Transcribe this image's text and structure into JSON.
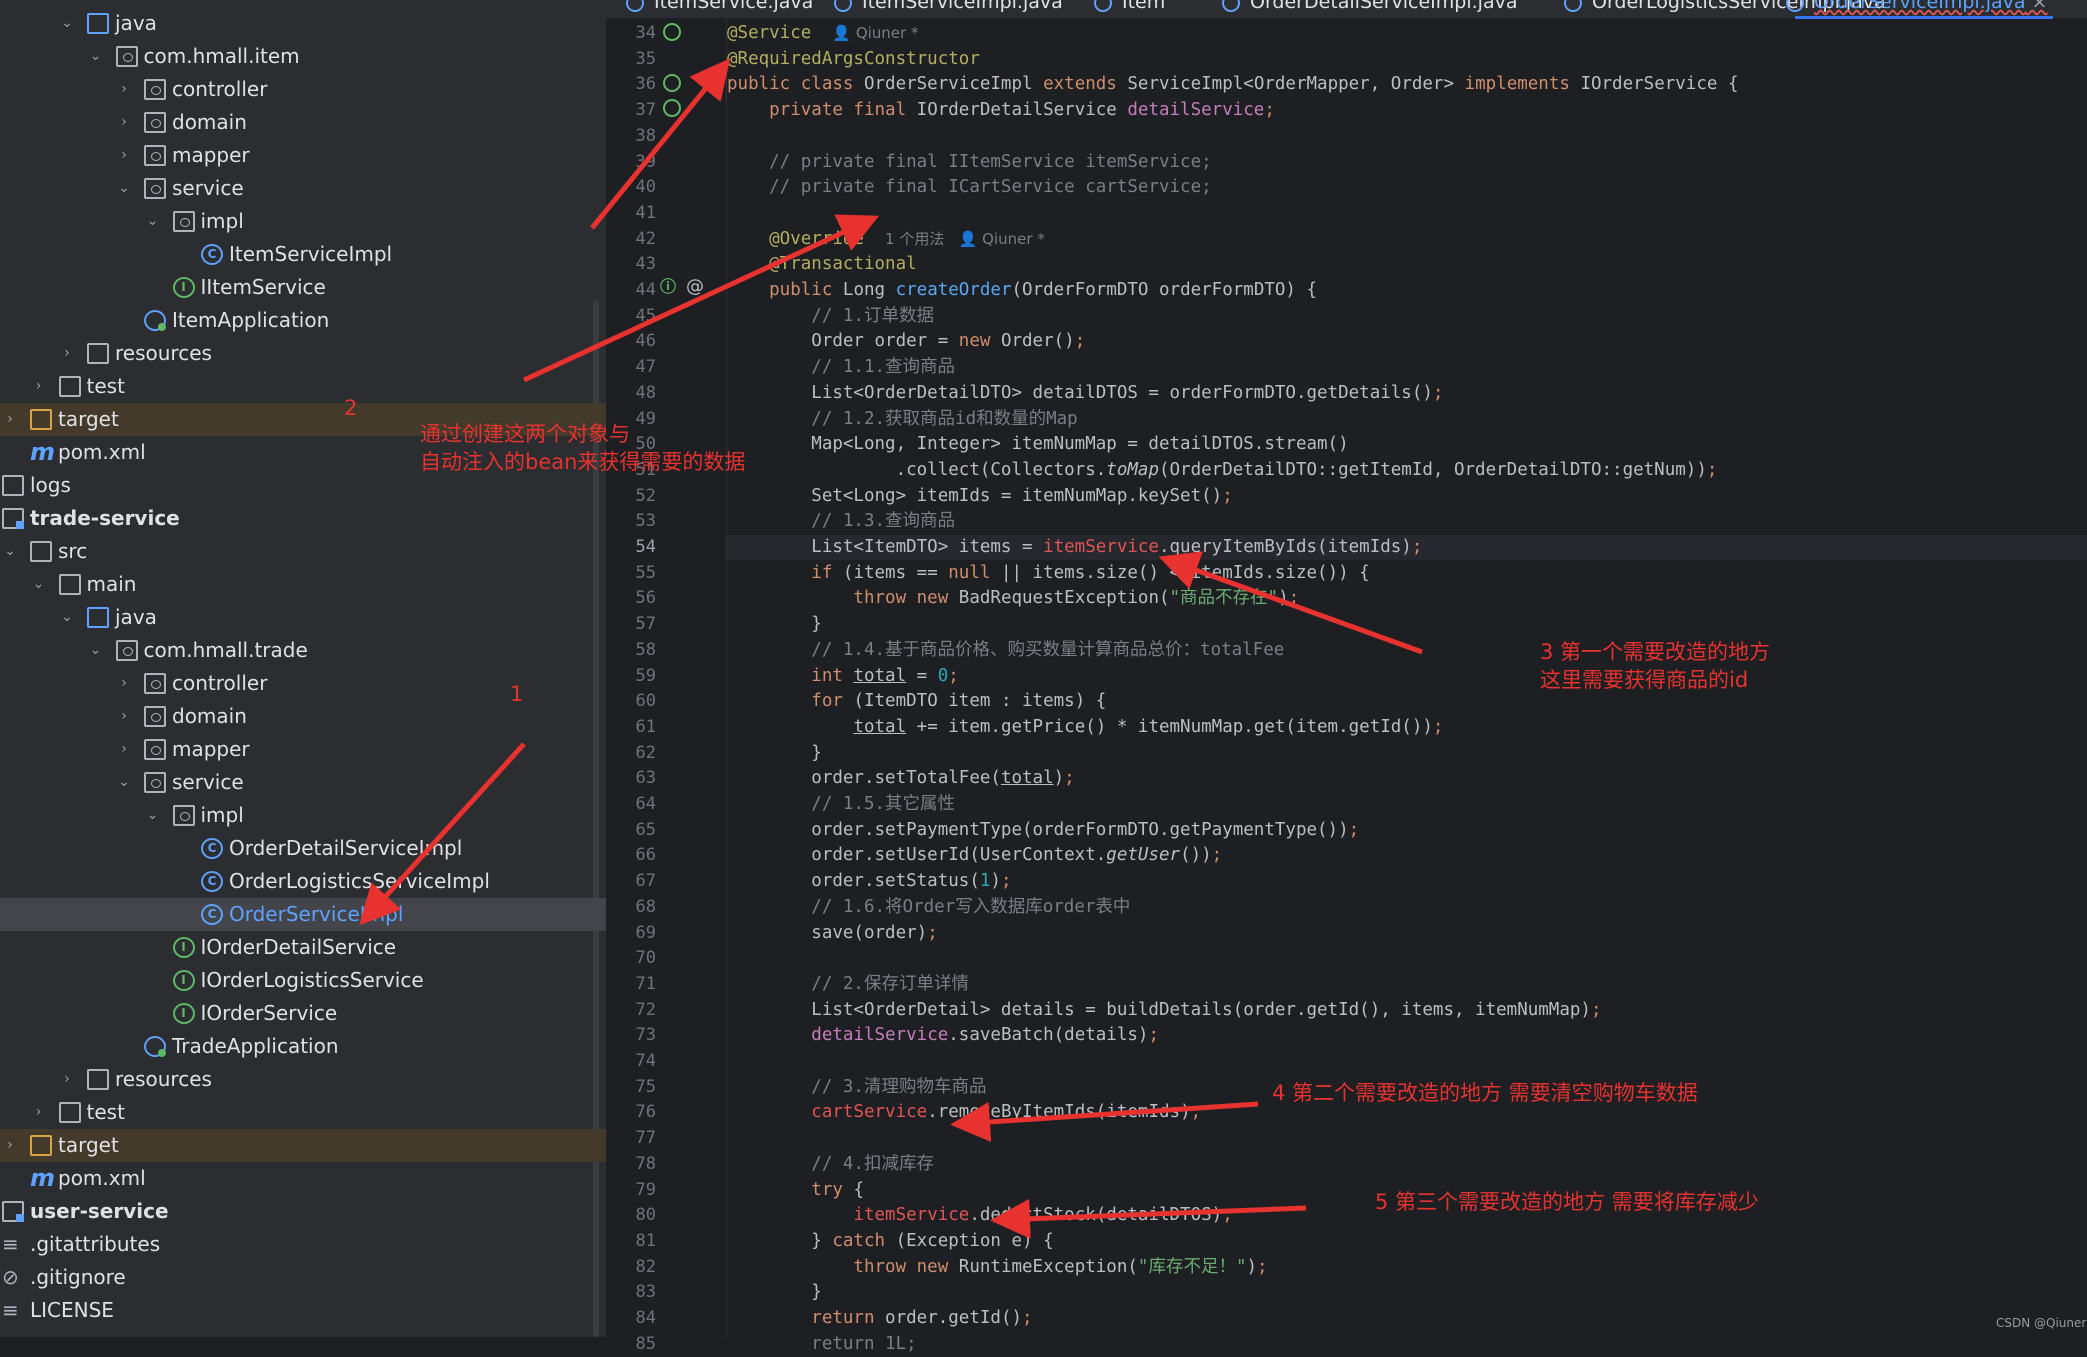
{
  "tabs": [
    {
      "label": "ItemService.java",
      "active": false
    },
    {
      "label": "ItemServiceImpl.java",
      "active": false
    },
    {
      "label": "Item",
      "active": false
    },
    {
      "label": "OrderDetailServiceImpl.java",
      "active": false
    },
    {
      "label": "OrderLogisticsServiceImpl.java",
      "active": false
    },
    {
      "label": "OrderServiceImpl.java",
      "active": true
    }
  ],
  "tree": [
    {
      "label": "java",
      "indent": 2,
      "chev": "v",
      "icon": "folder-src",
      "style": ""
    },
    {
      "label": "com.hmall.item",
      "indent": 3,
      "chev": "v",
      "icon": "folder-pkg",
      "style": ""
    },
    {
      "label": "controller",
      "indent": 4,
      "chev": ">",
      "icon": "folder-pkg",
      "style": ""
    },
    {
      "label": "domain",
      "indent": 4,
      "chev": ">",
      "icon": "folder-pkg",
      "style": ""
    },
    {
      "label": "mapper",
      "indent": 4,
      "chev": ">",
      "icon": "folder-pkg",
      "style": ""
    },
    {
      "label": "service",
      "indent": 4,
      "chev": "v",
      "icon": "folder-pkg",
      "style": ""
    },
    {
      "label": "impl",
      "indent": 5,
      "chev": "v",
      "icon": "folder-pkg",
      "style": ""
    },
    {
      "label": "ItemServiceImpl",
      "indent": 6,
      "chev": "",
      "icon": "class",
      "style": ""
    },
    {
      "label": "IItemService",
      "indent": 5,
      "chev": "",
      "icon": "iface",
      "style": ""
    },
    {
      "label": "ItemApplication",
      "indent": 4,
      "chev": "",
      "icon": "app",
      "style": ""
    },
    {
      "label": "resources",
      "indent": 2,
      "chev": ">",
      "icon": "folder",
      "style": ""
    },
    {
      "label": "test",
      "indent": 1,
      "chev": ">",
      "icon": "folder",
      "style": ""
    },
    {
      "label": "target",
      "indent": 0,
      "chev": ">",
      "icon": "folder-target",
      "style": "hl"
    },
    {
      "label": "pom.xml",
      "indent": 0,
      "chev": "",
      "icon": "maven",
      "style": ""
    },
    {
      "label": "logs",
      "indent": -1,
      "chev": "",
      "icon": "folder",
      "style": ""
    },
    {
      "label": "trade-service",
      "indent": -1,
      "chev": "",
      "icon": "module",
      "style": "bold"
    },
    {
      "label": "src",
      "indent": 0,
      "chev": "v",
      "icon": "folder",
      "style": ""
    },
    {
      "label": "main",
      "indent": 1,
      "chev": "v",
      "icon": "folder",
      "style": ""
    },
    {
      "label": "java",
      "indent": 2,
      "chev": "v",
      "icon": "folder-src",
      "style": ""
    },
    {
      "label": "com.hmall.trade",
      "indent": 3,
      "chev": "v",
      "icon": "folder-pkg",
      "style": ""
    },
    {
      "label": "controller",
      "indent": 4,
      "chev": ">",
      "icon": "folder-pkg",
      "style": ""
    },
    {
      "label": "domain",
      "indent": 4,
      "chev": ">",
      "icon": "folder-pkg",
      "style": ""
    },
    {
      "label": "mapper",
      "indent": 4,
      "chev": ">",
      "icon": "folder-pkg",
      "style": ""
    },
    {
      "label": "service",
      "indent": 4,
      "chev": "v",
      "icon": "folder-pkg",
      "style": ""
    },
    {
      "label": "impl",
      "indent": 5,
      "chev": "v",
      "icon": "folder-pkg",
      "style": ""
    },
    {
      "label": "OrderDetailServiceImpl",
      "indent": 6,
      "chev": "",
      "icon": "class",
      "style": ""
    },
    {
      "label": "OrderLogisticsServiceImpl",
      "indent": 6,
      "chev": "",
      "icon": "class",
      "style": ""
    },
    {
      "label": "OrderServiceImpl",
      "indent": 6,
      "chev": "",
      "icon": "class",
      "style": "sel"
    },
    {
      "label": "IOrderDetailService",
      "indent": 5,
      "chev": "",
      "icon": "iface",
      "style": ""
    },
    {
      "label": "IOrderLogisticsService",
      "indent": 5,
      "chev": "",
      "icon": "iface",
      "style": ""
    },
    {
      "label": "IOrderService",
      "indent": 5,
      "chev": "",
      "icon": "iface",
      "style": ""
    },
    {
      "label": "TradeApplication",
      "indent": 4,
      "chev": "",
      "icon": "app",
      "style": ""
    },
    {
      "label": "resources",
      "indent": 2,
      "chev": ">",
      "icon": "folder",
      "style": ""
    },
    {
      "label": "test",
      "indent": 1,
      "chev": ">",
      "icon": "folder",
      "style": ""
    },
    {
      "label": "target",
      "indent": 0,
      "chev": ">",
      "icon": "folder-target",
      "style": "hl"
    },
    {
      "label": "pom.xml",
      "indent": 0,
      "chev": "",
      "icon": "maven",
      "style": ""
    },
    {
      "label": "user-service",
      "indent": -1,
      "chev": "",
      "icon": "module",
      "style": "bold"
    },
    {
      "label": ".gitattributes",
      "indent": -1,
      "chev": "",
      "icon": "file-lines",
      "style": ""
    },
    {
      "label": ".gitignore",
      "indent": -1,
      "chev": "",
      "icon": "file-ignore",
      "style": ""
    },
    {
      "label": "LICENSE",
      "indent": -1,
      "chev": "",
      "icon": "file-lines",
      "style": ""
    }
  ],
  "code": [
    {
      "n": "34",
      "t": [
        [
          "@Service",
          "ann"
        ],
        [
          "  ",
          ""
        ],
        [
          "👤 Qiuner *",
          "inlay"
        ]
      ]
    },
    {
      "n": "35",
      "t": [
        [
          "@RequiredArgsConstructor",
          "ann"
        ]
      ]
    },
    {
      "n": "36",
      "t": [
        [
          "public class ",
          "kw"
        ],
        [
          "OrderServiceImpl ",
          ""
        ],
        [
          "extends ",
          "kw"
        ],
        [
          "ServiceImpl<OrderMapper, Order> ",
          ""
        ],
        [
          "implements ",
          "kw"
        ],
        [
          "IOrderService {",
          ""
        ]
      ]
    },
    {
      "n": "37",
      "t": [
        [
          "    private final ",
          "kw"
        ],
        [
          "IOrderDetailService ",
          ""
        ],
        [
          "detailService",
          "fld"
        ],
        [
          ";",
          "kw"
        ]
      ]
    },
    {
      "n": "38",
      "t": []
    },
    {
      "n": "39",
      "t": [
        [
          "    // private final IItemService itemService;",
          "com"
        ]
      ]
    },
    {
      "n": "40",
      "t": [
        [
          "    // private final ICartService cartService;",
          "com"
        ]
      ]
    },
    {
      "n": "41",
      "t": []
    },
    {
      "n": "42",
      "t": [
        [
          "    @Override",
          "ann"
        ],
        [
          "  ",
          ""
        ],
        [
          "1 个用法   👤 Qiuner *",
          "inlay"
        ]
      ]
    },
    {
      "n": "43",
      "t": [
        [
          "    @Transactional",
          "ann"
        ]
      ]
    },
    {
      "n": "44",
      "t": [
        [
          "    public ",
          "kw"
        ],
        [
          "Long ",
          ""
        ],
        [
          "createOrder",
          "fn"
        ],
        [
          "(OrderFormDTO orderFormDTO) {",
          ""
        ]
      ]
    },
    {
      "n": "45",
      "t": [
        [
          "        // 1.订单数据",
          "com"
        ]
      ]
    },
    {
      "n": "46",
      "t": [
        [
          "        Order order = ",
          ""
        ],
        [
          "new ",
          "kw"
        ],
        [
          "Order()",
          ""
        ],
        [
          ";",
          "kw"
        ]
      ]
    },
    {
      "n": "47",
      "t": [
        [
          "        // 1.1.查询商品",
          "com"
        ]
      ]
    },
    {
      "n": "48",
      "t": [
        [
          "        List<OrderDetailDTO> detailDTOS = orderFormDTO.getDetails()",
          ""
        ],
        [
          ";",
          "kw"
        ]
      ]
    },
    {
      "n": "49",
      "t": [
        [
          "        // 1.2.获取商品id和数量的Map",
          "com"
        ]
      ]
    },
    {
      "n": "50",
      "t": [
        [
          "        Map<Long, Integer> itemNumMap = detailDTOS.stream()",
          ""
        ]
      ]
    },
    {
      "n": "51",
      "t": [
        [
          "                .collect(Collectors.",
          ""
        ],
        [
          "toMap",
          "it"
        ],
        [
          "(OrderDetailDTO::getItemId, OrderDetailDTO::getNum))",
          ""
        ],
        [
          ";",
          "kw"
        ]
      ]
    },
    {
      "n": "52",
      "t": [
        [
          "        Set<Long> itemIds = itemNumMap.keySet()",
          ""
        ],
        [
          ";",
          "kw"
        ]
      ]
    },
    {
      "n": "53",
      "t": [
        [
          "        // 1.3.查询商品",
          "com"
        ]
      ]
    },
    {
      "n": "54",
      "t": [
        [
          "        List<ItemDTO> items = ",
          ""
        ],
        [
          "itemService",
          "err"
        ],
        [
          ".queryItemByIds(itemIds)",
          ""
        ],
        [
          ";",
          "kw"
        ]
      ]
    },
    {
      "n": "55",
      "t": [
        [
          "        if ",
          "kw"
        ],
        [
          "(items == ",
          ""
        ],
        [
          "null ",
          "kw"
        ],
        [
          "|| items.size() < itemIds.size()) {",
          ""
        ]
      ]
    },
    {
      "n": "56",
      "t": [
        [
          "            throw new ",
          "kw"
        ],
        [
          "BadRequestException(",
          ""
        ],
        [
          "\"商品不存在\"",
          "str"
        ],
        [
          ")",
          ""
        ],
        [
          ";",
          "kw"
        ]
      ]
    },
    {
      "n": "57",
      "t": [
        [
          "        }",
          ""
        ]
      ]
    },
    {
      "n": "58",
      "t": [
        [
          "        // 1.4.基于商品价格、购买数量计算商品总价：totalFee",
          "com"
        ]
      ]
    },
    {
      "n": "59",
      "t": [
        [
          "        int ",
          "kw"
        ],
        [
          "total",
          "ul"
        ],
        [
          " = ",
          ""
        ],
        [
          "0",
          "num"
        ],
        [
          ";",
          "kw"
        ]
      ]
    },
    {
      "n": "60",
      "t": [
        [
          "        for ",
          "kw"
        ],
        [
          "(ItemDTO item : items) {",
          ""
        ]
      ]
    },
    {
      "n": "61",
      "t": [
        [
          "            ",
          ""
        ],
        [
          "total",
          "ul"
        ],
        [
          " += item.getPrice() * itemNumMap.get(item.getId())",
          ""
        ],
        [
          ";",
          "kw"
        ]
      ]
    },
    {
      "n": "62",
      "t": [
        [
          "        }",
          ""
        ]
      ]
    },
    {
      "n": "63",
      "t": [
        [
          "        order.setTotalFee(",
          ""
        ],
        [
          "total",
          "ul"
        ],
        [
          ")",
          ""
        ],
        [
          ";",
          "kw"
        ]
      ]
    },
    {
      "n": "64",
      "t": [
        [
          "        // 1.5.其它属性",
          "com"
        ]
      ]
    },
    {
      "n": "65",
      "t": [
        [
          "        order.setPaymentType(orderFormDTO.getPaymentType())",
          ""
        ],
        [
          ";",
          "kw"
        ]
      ]
    },
    {
      "n": "66",
      "t": [
        [
          "        order.setUserId(UserContext.",
          ""
        ],
        [
          "getUser",
          "it"
        ],
        [
          "())",
          ""
        ],
        [
          ";",
          "kw"
        ]
      ]
    },
    {
      "n": "67",
      "t": [
        [
          "        order.setStatus(",
          ""
        ],
        [
          "1",
          "num"
        ],
        [
          ")",
          ""
        ],
        [
          ";",
          "kw"
        ]
      ]
    },
    {
      "n": "68",
      "t": [
        [
          "        // 1.6.将Order写入数据库order表中",
          "com"
        ]
      ]
    },
    {
      "n": "69",
      "t": [
        [
          "        save(order)",
          ""
        ],
        [
          ";",
          "kw"
        ]
      ]
    },
    {
      "n": "70",
      "t": []
    },
    {
      "n": "71",
      "t": [
        [
          "        // 2.保存订单详情",
          "com"
        ]
      ]
    },
    {
      "n": "72",
      "t": [
        [
          "        List<OrderDetail> details = buildDetails(order.getId(), items, itemNumMap)",
          ""
        ],
        [
          ";",
          "kw"
        ]
      ]
    },
    {
      "n": "73",
      "t": [
        [
          "        ",
          ""
        ],
        [
          "detailService",
          "fld"
        ],
        [
          ".saveBatch(details)",
          ""
        ],
        [
          ";",
          "kw"
        ]
      ]
    },
    {
      "n": "74",
      "t": []
    },
    {
      "n": "75",
      "t": [
        [
          "        // 3.清理购物车商品",
          "com"
        ]
      ]
    },
    {
      "n": "76",
      "t": [
        [
          "        ",
          ""
        ],
        [
          "cartService",
          "err"
        ],
        [
          ".removeByItemIds(itemIds)",
          ""
        ],
        [
          ";",
          "kw"
        ]
      ]
    },
    {
      "n": "77",
      "t": []
    },
    {
      "n": "78",
      "t": [
        [
          "        // 4.扣减库存",
          "com"
        ]
      ]
    },
    {
      "n": "79",
      "t": [
        [
          "        try ",
          "kw"
        ],
        [
          "{",
          ""
        ]
      ]
    },
    {
      "n": "80",
      "t": [
        [
          "            ",
          ""
        ],
        [
          "itemService",
          "err"
        ],
        [
          ".deductStock(detailDTOS)",
          ""
        ],
        [
          ";",
          "kw"
        ]
      ]
    },
    {
      "n": "81",
      "t": [
        [
          "        } ",
          ""
        ],
        [
          "catch ",
          "kw"
        ],
        [
          "(Exception e) {",
          ""
        ]
      ]
    },
    {
      "n": "82",
      "t": [
        [
          "            throw new ",
          "kw"
        ],
        [
          "RuntimeException(",
          ""
        ],
        [
          "\"库存不足！\"",
          "str"
        ],
        [
          ")",
          ""
        ],
        [
          ";",
          "kw"
        ]
      ]
    },
    {
      "n": "83",
      "t": [
        [
          "        }",
          ""
        ]
      ]
    },
    {
      "n": "84",
      "t": [
        [
          "        return ",
          "kw"
        ],
        [
          "order.getId()",
          ""
        ],
        [
          ";",
          "kw"
        ]
      ]
    },
    {
      "n": "85",
      "t": [
        [
          "        return 1L;",
          "com"
        ]
      ]
    }
  ],
  "notes": {
    "n1": "1",
    "n2": "2",
    "n2_line1": "通过创建这两个对象与",
    "n2_line2": "自动注入的bean来获得需要的数据",
    "n3_line1": "3 第一个需要改造的地方",
    "n3_line2": "这里需要获得商品的id",
    "n4": "4 第二个需要改造的地方 需要清空购物车数据",
    "n5": "5 第三个需要改造的地方 需要将库存减少"
  },
  "watermark": "CSDN @Qiuner",
  "colors": {
    "annotation": "#e8322f",
    "accent": "#3574f0"
  }
}
